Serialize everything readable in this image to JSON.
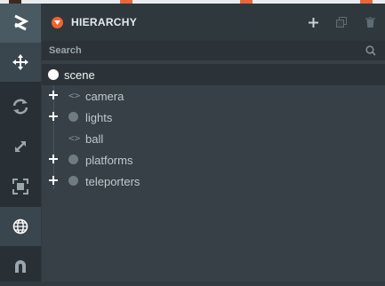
{
  "browser": {
    "chips": [
      {
        "color": "#3a2a20"
      },
      {
        "color": "#e8663a"
      },
      {
        "color": "#e8663a"
      },
      {
        "color": "#e8663a"
      }
    ]
  },
  "toolbar": {
    "tools": [
      {
        "name": "logo-icon",
        "active": false
      },
      {
        "name": "translate-icon",
        "active": true
      },
      {
        "name": "rotate-icon",
        "active": false
      },
      {
        "name": "scale-icon",
        "active": false
      },
      {
        "name": "resize-icon",
        "active": false
      },
      {
        "name": "world-space-icon",
        "active": false
      },
      {
        "name": "magnet-icon",
        "active": false
      }
    ]
  },
  "panel": {
    "title": "HIERARCHY",
    "search_placeholder": "Search",
    "actions": [
      "add-entity-icon",
      "duplicate-icon",
      "delete-icon"
    ]
  },
  "hierarchy": {
    "root": {
      "label": "scene",
      "selected": true
    },
    "children": [
      {
        "label": "camera",
        "has_children": true,
        "kind": "template"
      },
      {
        "label": "lights",
        "has_children": true,
        "kind": "entity"
      },
      {
        "label": "ball",
        "has_children": false,
        "kind": "template"
      },
      {
        "label": "platforms",
        "has_children": true,
        "kind": "entity"
      },
      {
        "label": "teleporters",
        "has_children": true,
        "kind": "entity"
      }
    ]
  },
  "colors": {
    "accent": "#f0632e",
    "panel_bg": "#364046",
    "toolbar_bg": "#293035"
  }
}
